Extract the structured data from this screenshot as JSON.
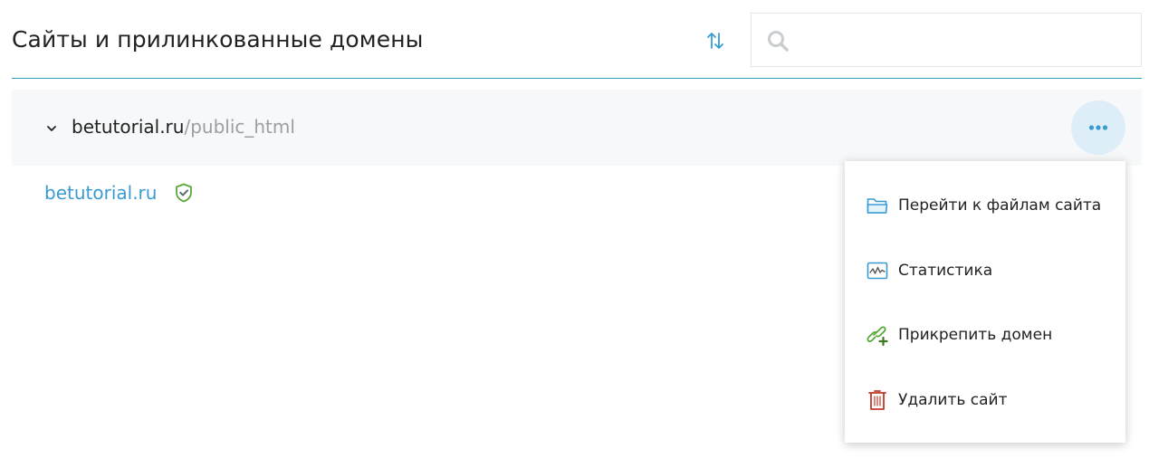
{
  "header": {
    "title": "Сайты и прилинкованные домены",
    "search_placeholder": ""
  },
  "site": {
    "domain": "betutorial.ru",
    "path": "/public_html"
  },
  "linked_domains": [
    {
      "name": "betutorial.ru",
      "ssl_icon": "shield-check-icon"
    }
  ],
  "context_menu": {
    "items": [
      {
        "label": "Перейти к файлам сайта",
        "icon": "folder-icon",
        "color": "#3a9bd1"
      },
      {
        "label": "Статистика",
        "icon": "statistics-icon",
        "color": "#3a9bd1"
      },
      {
        "label": "Прикрепить домен",
        "icon": "link-add-icon",
        "color": "#5aa83a"
      },
      {
        "label": "Удалить сайт",
        "icon": "trash-icon",
        "color": "#c0392b"
      }
    ]
  },
  "colors": {
    "accent": "#3a9bd1",
    "divider": "#2aa3b5",
    "row_bg": "#f6f8f9",
    "ssl_green": "#5aa83a",
    "danger": "#c0392b"
  }
}
